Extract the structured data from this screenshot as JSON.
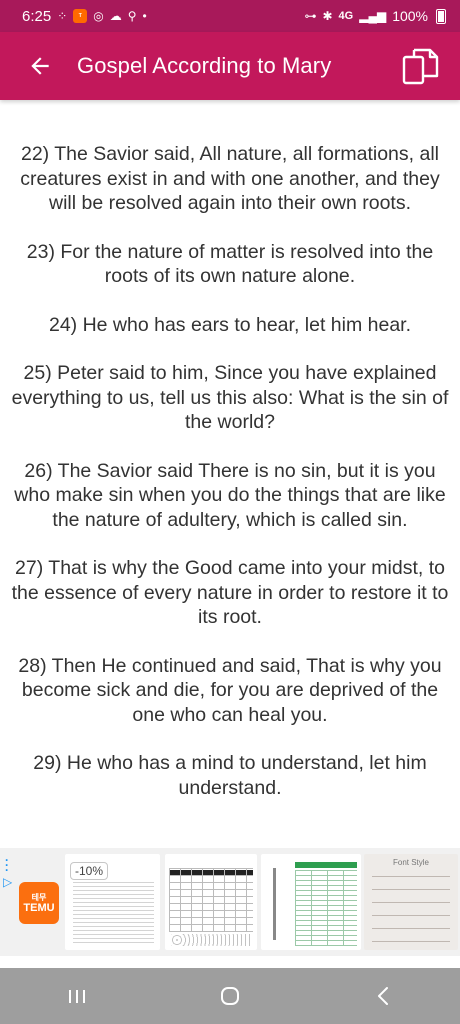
{
  "status_bar": {
    "time": "6:25",
    "network": "4G",
    "battery": "100%"
  },
  "app_bar": {
    "title": "Gospel According to Mary",
    "back_icon": "arrow-left-icon",
    "copy_icon": "copy-icon"
  },
  "verses": [
    "22) The Savior said, All nature, all formations, all creatures exist in and with one another, and they will be resolved again into their own roots.",
    "23) For the nature of matter is resolved into the roots of its own nature alone.",
    "24) He who has ears to hear, let him hear.",
    "25) Peter said to him, Since you have explained everything to us, tell us this also: What is the sin of the world?",
    "26) The Savior said There is no sin, but it is you who make sin when you do the things that are like the nature of adultery, which is called sin.",
    "27) That is why the Good came into your midst, to the essence of every nature in order to restore it to its root.",
    "28) Then He continued and said, That is why you become sick and die, for you are deprived of the one who can heal you.",
    "29) He who has a mind to understand, let him understand."
  ],
  "ad": {
    "brand": "TEMU",
    "brand_sub": "테무",
    "discount": "-10%",
    "font_style_label": "Font Style"
  },
  "nav_bar": {
    "recent_icon": "recent-apps-icon",
    "home_icon": "home-icon",
    "back_icon": "back-icon"
  },
  "colors": {
    "status_bar": "#a8195a",
    "app_bar": "#c2185b",
    "text": "#333333",
    "nav_bar": "#9e9e9e"
  }
}
